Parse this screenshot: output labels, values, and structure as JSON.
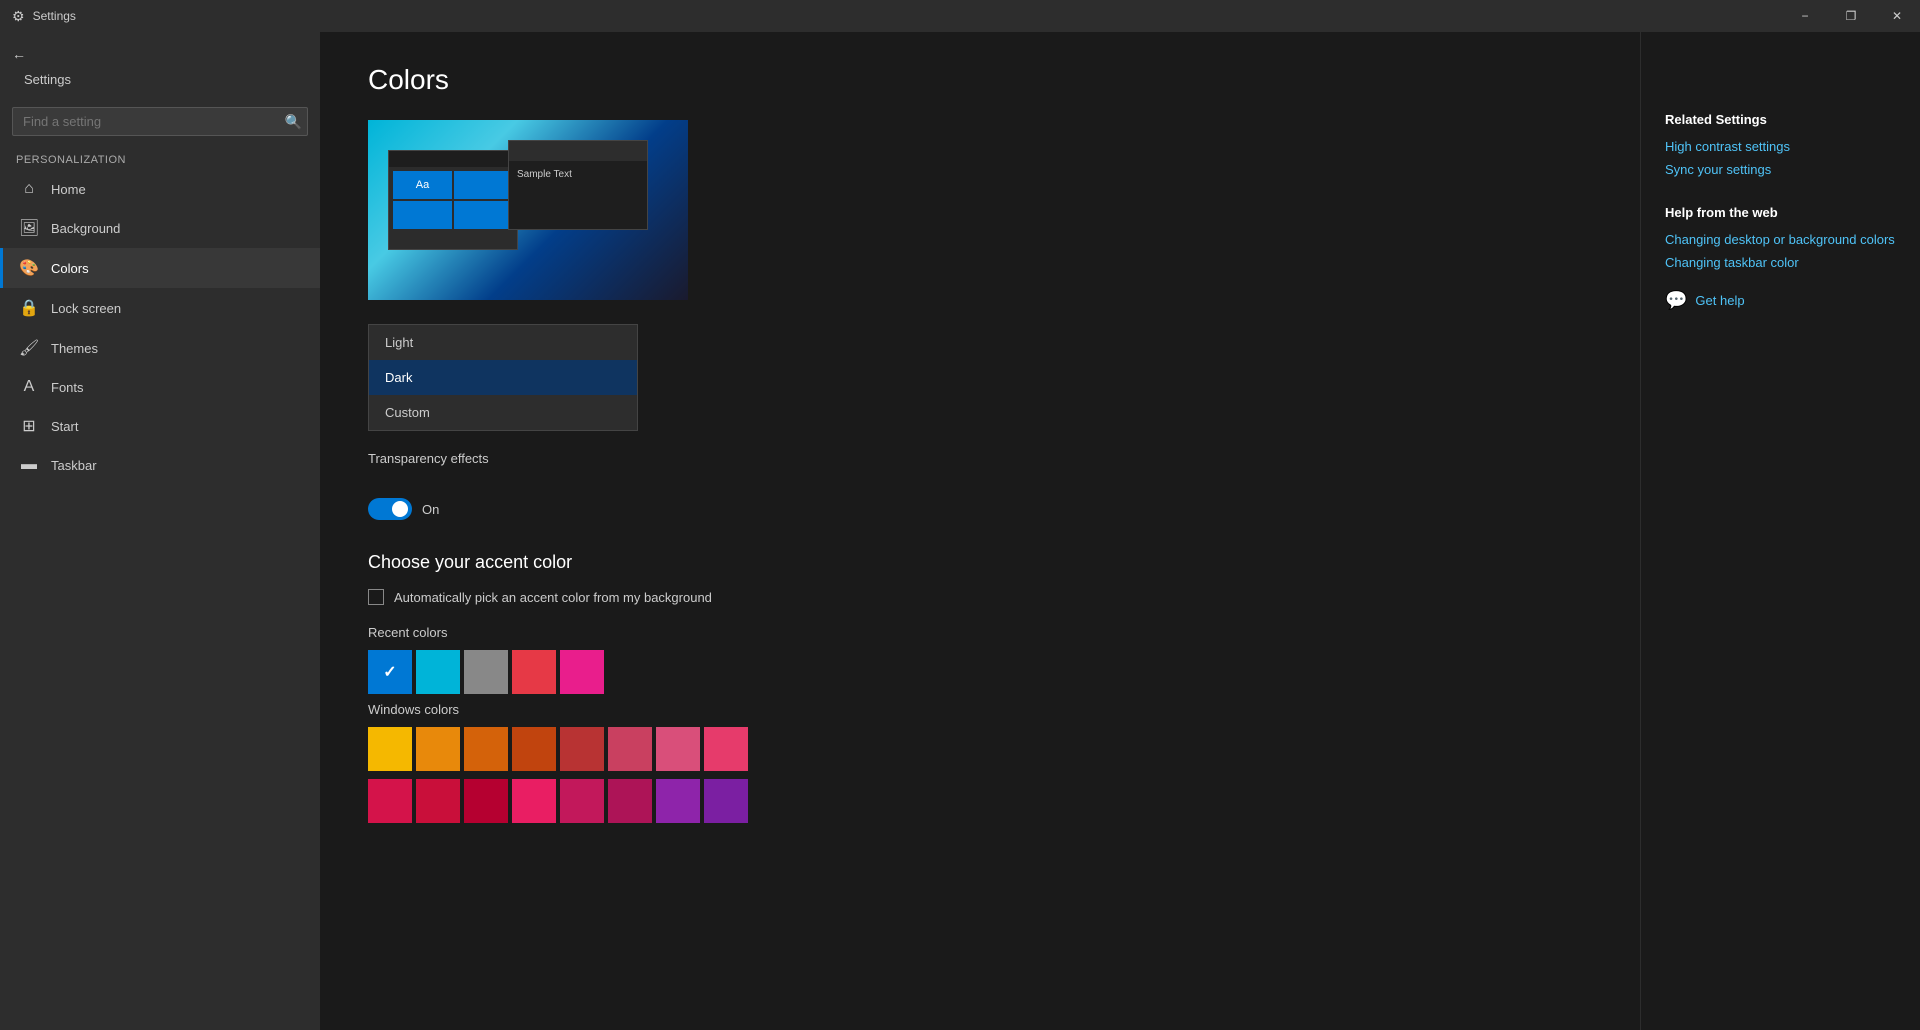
{
  "titlebar": {
    "title": "Settings",
    "minimize_label": "−",
    "maximize_label": "❐",
    "close_label": "✕"
  },
  "sidebar": {
    "back_label": "Settings",
    "search_placeholder": "Find a setting",
    "section_label": "Personalization",
    "items": [
      {
        "id": "home",
        "icon": "⌂",
        "label": "Home"
      },
      {
        "id": "background",
        "icon": "🖼",
        "label": "Background"
      },
      {
        "id": "colors",
        "icon": "🎨",
        "label": "Colors"
      },
      {
        "id": "lock-screen",
        "icon": "🔒",
        "label": "Lock screen"
      },
      {
        "id": "themes",
        "icon": "🖌",
        "label": "Themes"
      },
      {
        "id": "fonts",
        "icon": "A",
        "label": "Fonts"
      },
      {
        "id": "start",
        "icon": "⊞",
        "label": "Start"
      },
      {
        "id": "taskbar",
        "icon": "▬",
        "label": "Taskbar"
      }
    ]
  },
  "main": {
    "page_title": "Colors",
    "preview": {
      "sample_text": "Sample Text",
      "sample_aa": "Aa"
    },
    "dropdown": {
      "items": [
        {
          "id": "light",
          "label": "Light"
        },
        {
          "id": "dark",
          "label": "Dark",
          "selected": true
        },
        {
          "id": "custom",
          "label": "Custom"
        }
      ]
    },
    "transparency": {
      "label": "Transparency effects",
      "status": "On",
      "enabled": true
    },
    "accent": {
      "title": "Choose your accent color",
      "auto_label": "Automatically pick an accent color from my background",
      "auto_checked": false
    },
    "recent_colors": {
      "label": "Recent colors",
      "swatches": [
        {
          "color": "#0078d4",
          "selected": true
        },
        {
          "color": "#00b4d8",
          "selected": false
        },
        {
          "color": "#888888",
          "selected": false
        },
        {
          "color": "#e63946",
          "selected": false
        },
        {
          "color": "#e91e8c",
          "selected": false
        }
      ]
    },
    "windows_colors": {
      "label": "Windows colors",
      "swatches_row1": [
        "#f5b800",
        "#e8890b",
        "#d4620a",
        "#c1440e",
        "#b83333",
        "#c94060",
        "#d94f7a",
        "#e63b6b"
      ],
      "swatches_row2": [
        "#d4134a",
        "#c90f3a",
        "#b50030",
        "#e91e63",
        "#c2185b",
        "#ad1457",
        "#8e24aa",
        "#7b1fa2"
      ]
    }
  },
  "right_panel": {
    "related_title": "Related Settings",
    "related_links": [
      {
        "id": "high-contrast",
        "label": "High contrast settings"
      },
      {
        "id": "sync-settings",
        "label": "Sync your settings"
      }
    ],
    "help_title": "Help from the web",
    "help_links": [
      {
        "id": "change-desktop",
        "label": "Changing desktop or background colors"
      },
      {
        "id": "change-taskbar",
        "label": "Changing taskbar color"
      }
    ],
    "get_help_label": "Get help"
  }
}
